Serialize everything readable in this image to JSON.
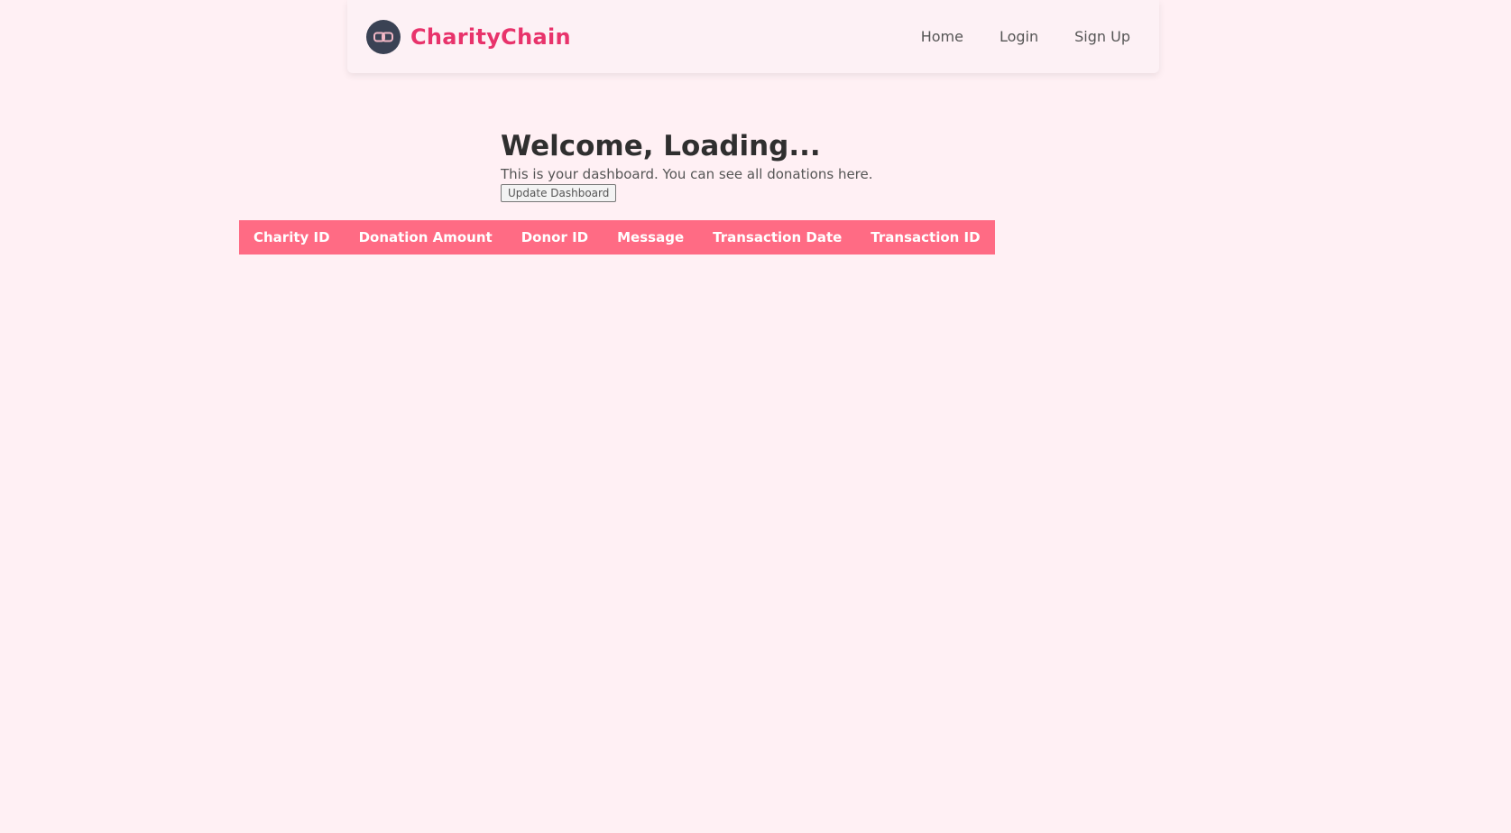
{
  "header": {
    "brand_name": "CharityChain",
    "logo_icon": "chain-link-icon",
    "nav": {
      "home": "Home",
      "login": "Login",
      "signup": "Sign Up"
    }
  },
  "main": {
    "title": "Welcome, Loading...",
    "subtitle": "This is your dashboard. You can see all donations here.",
    "update_button": "Update Dashboard"
  },
  "table": {
    "columns": [
      "Charity ID",
      "Donation Amount",
      "Donor ID",
      "Message",
      "Transaction Date",
      "Transaction ID"
    ],
    "rows": []
  },
  "colors": {
    "background": "#fff0f4",
    "brand": "#e8336b",
    "table_header": "#ff6b84",
    "logo_bg": "#3a4254"
  }
}
